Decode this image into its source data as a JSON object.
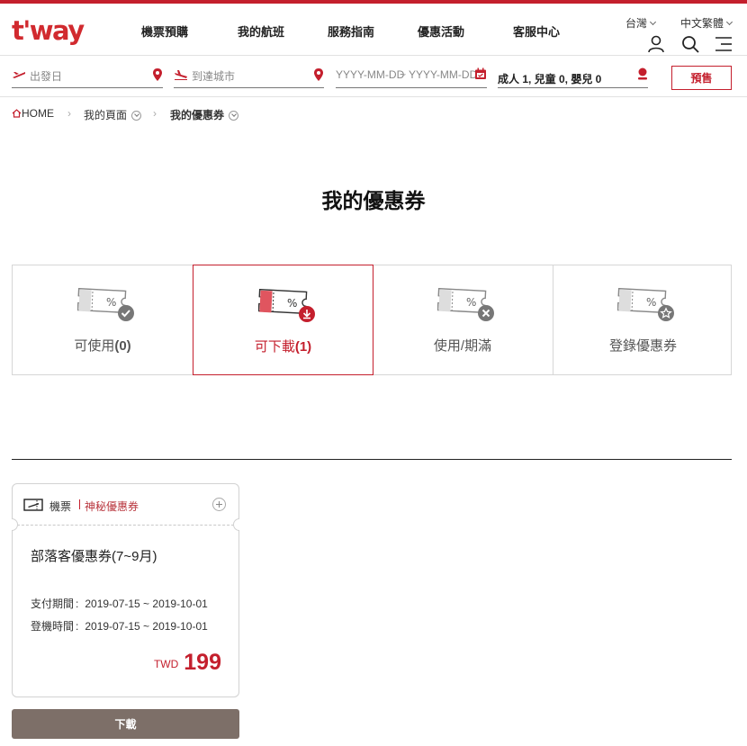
{
  "brand": {
    "logo": "t'way",
    "accent": "#c41f2d"
  },
  "header": {
    "nav": [
      "機票預購",
      "我的航班",
      "服務指南",
      "優惠活動",
      "客服中心"
    ],
    "country": "台灣",
    "language": "中文繁體",
    "icons": [
      "user-icon",
      "search-icon",
      "menu-icon"
    ]
  },
  "search": {
    "departure_placeholder": "出發日",
    "arrival_placeholder": "到達城市",
    "date_start_placeholder": "YYYY-MM-DD",
    "date_sep": "~",
    "date_end_placeholder": "YYYY-MM-DD",
    "passengers": "成人 1, 兒童 0, 嬰兒 0",
    "booking_label": "預售"
  },
  "breadcrumb": {
    "home": "HOME",
    "level1": "我的頁面",
    "level2": "我的優惠券"
  },
  "page": {
    "title": "我的優惠券"
  },
  "tabs": [
    {
      "label": "可使用",
      "count": "(0)",
      "badge": "check-icon",
      "active": false
    },
    {
      "label": "可下載",
      "count": "(1)",
      "badge": "download-icon",
      "active": true
    },
    {
      "label": "使用/期滿",
      "count": "",
      "badge": "x-icon",
      "active": false
    },
    {
      "label": "登錄優惠券",
      "count": "",
      "badge": "star-icon",
      "active": false
    }
  ],
  "coupon": {
    "type": "機票",
    "name": "神秘優惠券",
    "title": "部落客優惠券(7~9月)",
    "payment_label": "支付期間",
    "payment_period": "2019-07-15 ~ 2019-10-01",
    "boarding_label": "登機時間",
    "boarding_period": "2019-07-15 ~ 2019-10-01",
    "currency": "TWD",
    "amount": "199"
  },
  "download_label": "下載"
}
